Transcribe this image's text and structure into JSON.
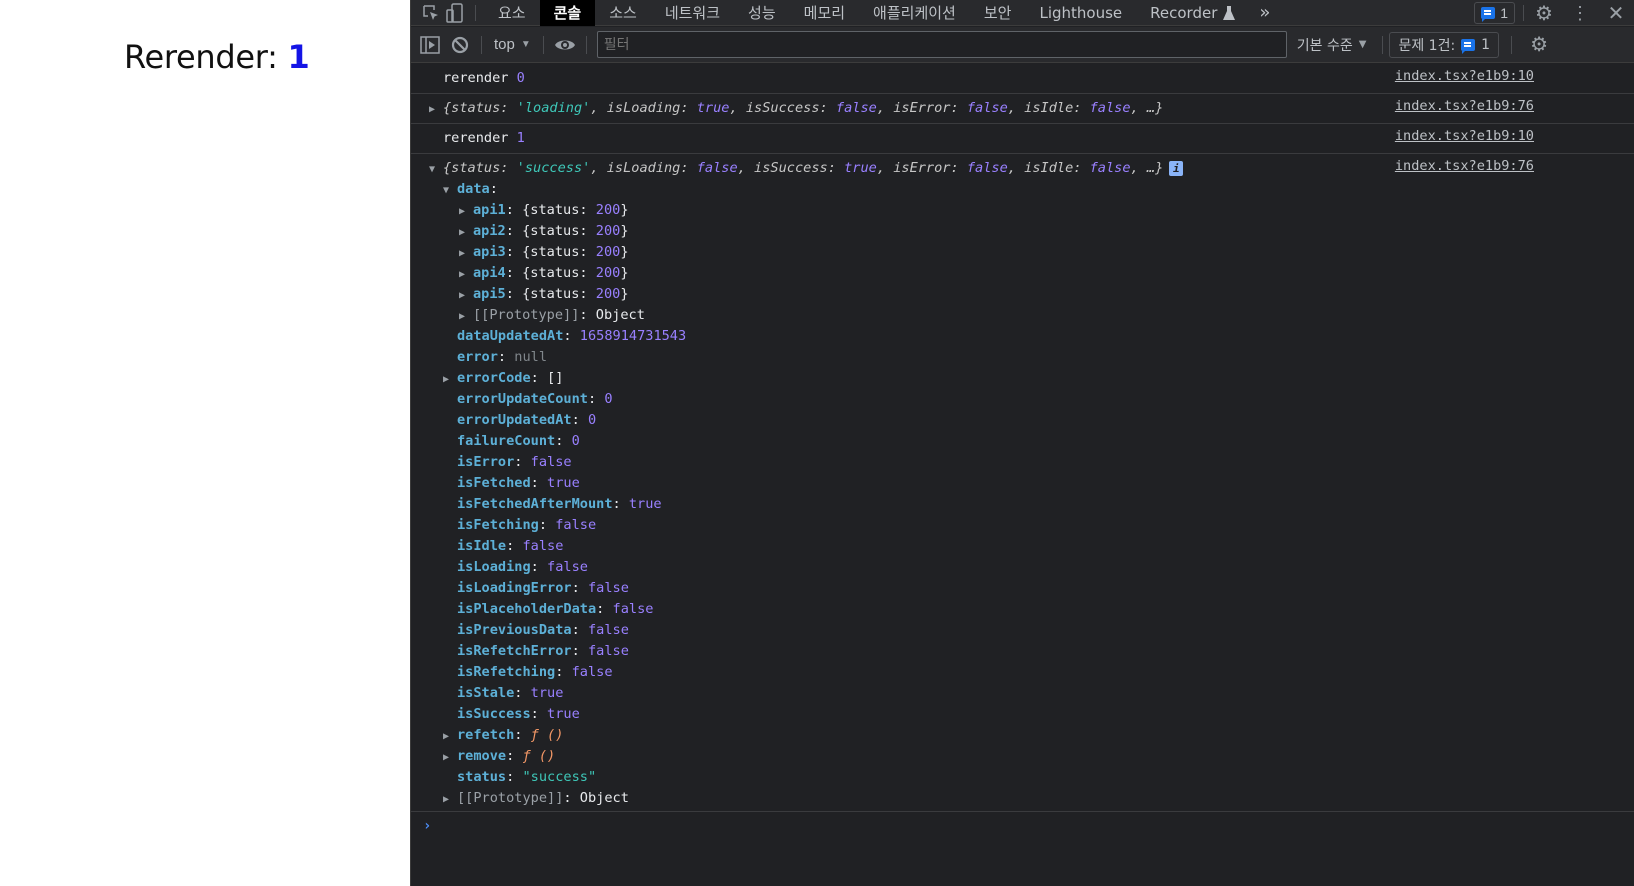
{
  "page": {
    "label": "Rerender: ",
    "count": "1"
  },
  "tabs": [
    {
      "label": "요소",
      "active": false
    },
    {
      "label": "콘솔",
      "active": true
    },
    {
      "label": "소스",
      "active": false
    },
    {
      "label": "네트워크",
      "active": false
    },
    {
      "label": "성능",
      "active": false
    },
    {
      "label": "메모리",
      "active": false
    },
    {
      "label": "애플리케이션",
      "active": false
    },
    {
      "label": "보안",
      "active": false
    },
    {
      "label": "Lighthouse",
      "active": false
    },
    {
      "label": "Recorder",
      "active": false
    }
  ],
  "tabbar": {
    "more_label": "»",
    "messages_count": "1",
    "icons": [
      "inspect-icon",
      "device-toolbar-icon",
      "flask-icon",
      "message-icon",
      "gear-icon",
      "more-vertical-icon",
      "close-icon"
    ]
  },
  "toolbar": {
    "context": "top",
    "filter_placeholder": "필터",
    "level": "기본 수준",
    "issues_label": "문제 1건:",
    "issues_count": "1"
  },
  "console": {
    "messages": [
      {
        "text": "rerender",
        "value": "0",
        "source": "index.tsx?e1b9:10"
      },
      {
        "source": "index.tsx?e1b9:76",
        "summary": {
          "status": "'loading'",
          "isLoading": "true",
          "isSuccess": "false",
          "isError": "false",
          "isIdle": "false",
          "ellipsis": "…}"
        }
      },
      {
        "text": "rerender",
        "value": "1",
        "source": "index.tsx?e1b9:10"
      },
      {
        "source": "index.tsx?e1b9:76",
        "summary": {
          "status": "'success'",
          "isLoading": "false",
          "isSuccess": "true",
          "isError": "false",
          "isIdle": "false",
          "ellipsis": "…}"
        },
        "info_badge": "i"
      }
    ],
    "expanded": {
      "data_key": "data",
      "data_children": [
        {
          "key": "api1",
          "value": "{status: ",
          "num": "200"
        },
        {
          "key": "api2",
          "value": "{status: ",
          "num": "200"
        },
        {
          "key": "api3",
          "value": "{status: ",
          "num": "200"
        },
        {
          "key": "api4",
          "value": "{status: ",
          "num": "200"
        },
        {
          "key": "api5",
          "value": "{status: ",
          "num": "200"
        }
      ],
      "data_prototype": {
        "key": "[[Prototype]]",
        "value": "Object"
      },
      "props": [
        {
          "key": "dataUpdatedAt",
          "value": "1658914731543",
          "type": "num",
          "expandable": false
        },
        {
          "key": "error",
          "value": "null",
          "type": "nul",
          "expandable": false
        },
        {
          "key": "errorCode",
          "value": "[]",
          "type": "p",
          "expandable": true
        },
        {
          "key": "errorUpdateCount",
          "value": "0",
          "type": "num",
          "expandable": false
        },
        {
          "key": "errorUpdatedAt",
          "value": "0",
          "type": "num",
          "expandable": false
        },
        {
          "key": "failureCount",
          "value": "0",
          "type": "num",
          "expandable": false
        },
        {
          "key": "isError",
          "value": "false",
          "type": "bool",
          "expandable": false
        },
        {
          "key": "isFetched",
          "value": "true",
          "type": "bool",
          "expandable": false
        },
        {
          "key": "isFetchedAfterMount",
          "value": "true",
          "type": "bool",
          "expandable": false
        },
        {
          "key": "isFetching",
          "value": "false",
          "type": "bool",
          "expandable": false
        },
        {
          "key": "isIdle",
          "value": "false",
          "type": "bool",
          "expandable": false
        },
        {
          "key": "isLoading",
          "value": "false",
          "type": "bool",
          "expandable": false
        },
        {
          "key": "isLoadingError",
          "value": "false",
          "type": "bool",
          "expandable": false
        },
        {
          "key": "isPlaceholderData",
          "value": "false",
          "type": "bool",
          "expandable": false
        },
        {
          "key": "isPreviousData",
          "value": "false",
          "type": "bool",
          "expandable": false
        },
        {
          "key": "isRefetchError",
          "value": "false",
          "type": "bool",
          "expandable": false
        },
        {
          "key": "isRefetching",
          "value": "false",
          "type": "bool",
          "expandable": false
        },
        {
          "key": "isStale",
          "value": "true",
          "type": "bool",
          "expandable": false
        },
        {
          "key": "isSuccess",
          "value": "true",
          "type": "bool",
          "expandable": false
        },
        {
          "key": "refetch",
          "value": "ƒ ()",
          "type": "fn",
          "expandable": true
        },
        {
          "key": "remove",
          "value": "ƒ ()",
          "type": "fn",
          "expandable": true
        },
        {
          "key": "status",
          "value": "\"success\"",
          "type": "str",
          "expandable": false
        },
        {
          "key": "[[Prototype]]",
          "value": "Object",
          "type": "p",
          "expandable": true,
          "internal": true
        }
      ]
    },
    "prompt": "›"
  }
}
